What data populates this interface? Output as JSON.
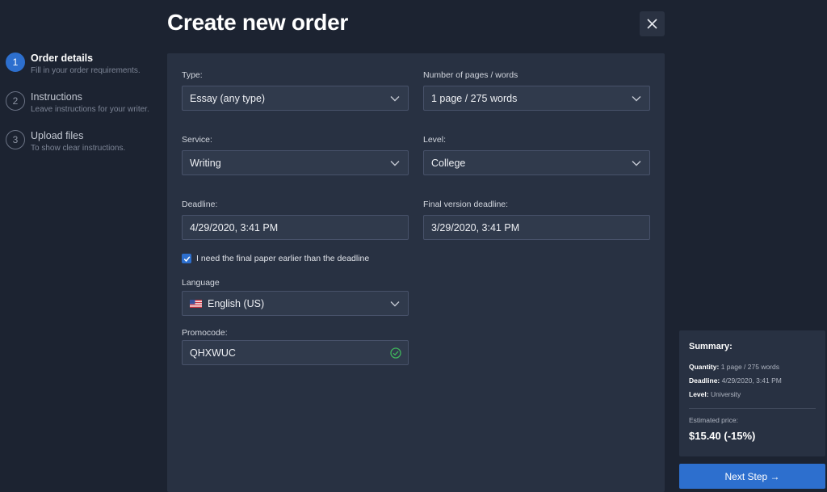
{
  "title": "Create new order",
  "steps": [
    {
      "num": "1",
      "title": "Order details",
      "subtitle": "Fill in your order requirements."
    },
    {
      "num": "2",
      "title": "Instructions",
      "subtitle": "Leave instructions for your writer."
    },
    {
      "num": "3",
      "title": "Upload files",
      "subtitle": "To show clear instructions."
    }
  ],
  "form": {
    "type": {
      "label": "Type:",
      "value": "Essay (any type)"
    },
    "pages": {
      "label": "Number of pages / words",
      "value": "1 page / 275 words"
    },
    "service": {
      "label": "Service:",
      "value": "Writing"
    },
    "level": {
      "label": "Level:",
      "value": "College"
    },
    "deadline": {
      "label": "Deadline:",
      "value": "4/29/2020, 3:41 PM"
    },
    "final_deadline": {
      "label": "Final version deadline:",
      "value": "3/29/2020, 3:41 PM"
    },
    "early_checkbox": {
      "label": "I need the final paper earlier than the deadline",
      "checked": true
    },
    "language": {
      "label": "Language",
      "value": "English (US)"
    },
    "promocode": {
      "label": "Promocode:",
      "value": "QHXWUC"
    }
  },
  "summary": {
    "title": "Summary:",
    "quantity_label": "Quantity:",
    "quantity_value": "1 page / 275 words",
    "deadline_label": "Deadline:",
    "deadline_value": "4/29/2020, 3:41 PM",
    "level_label": "Level:",
    "level_value": "University",
    "estimated_label": "Estimated price:",
    "price": "$15.40 (-15%)"
  },
  "next_button": "Next Step →",
  "colors": {
    "accent": "#2d6fce",
    "background": "#1c2331",
    "panel": "#283142",
    "success": "#3fb45c"
  },
  "icons": {
    "close": "close-icon",
    "chevron": "chevron-down-icon",
    "flag": "us-flag-icon",
    "valid": "check-circle-icon",
    "checkbox": "checkmark-icon"
  }
}
